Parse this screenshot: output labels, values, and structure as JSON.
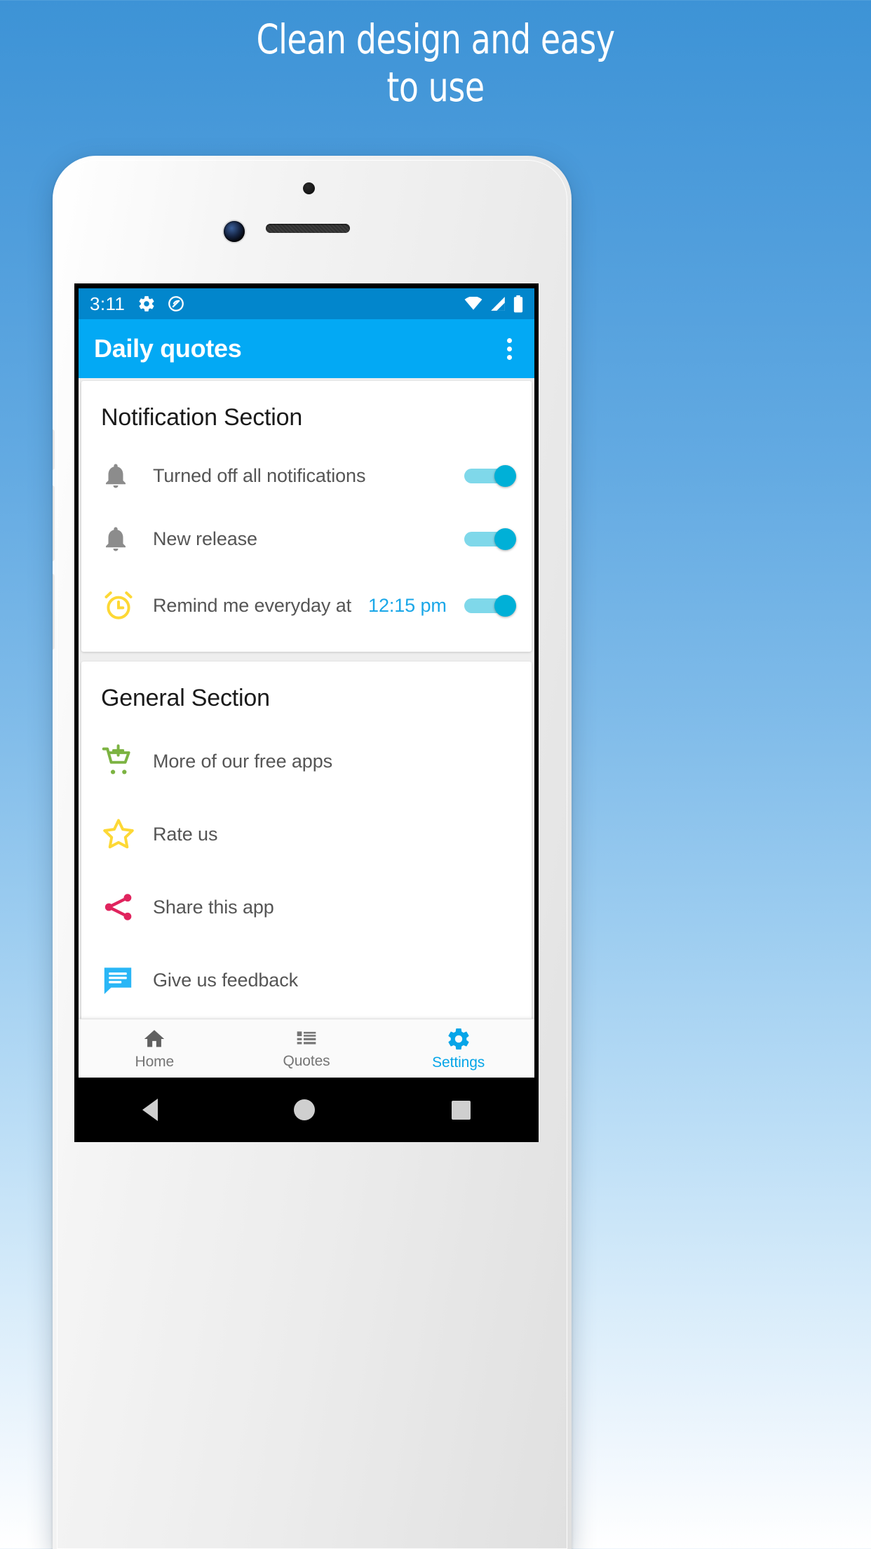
{
  "headline": {
    "line1": "Clean design and easy",
    "line2": "to use"
  },
  "status_bar": {
    "time": "3:11",
    "icons": [
      "gear-icon",
      "do-not-disturb-icon"
    ],
    "right_icons": [
      "wifi-icon",
      "signal-icon",
      "battery-icon"
    ]
  },
  "app_bar": {
    "title": "Daily quotes",
    "overflow": "more-options"
  },
  "notification_section": {
    "title": "Notification Section",
    "rows": [
      {
        "icon": "bell-icon",
        "label": "Turned off all notifications",
        "toggle": "on"
      },
      {
        "icon": "bell-icon",
        "label": "New release",
        "toggle": "on"
      },
      {
        "icon": "alarm-clock-icon",
        "label": "Remind me everyday at",
        "value": "12:15 pm",
        "toggle": "on"
      }
    ]
  },
  "general_section": {
    "title": "General Section",
    "rows": [
      {
        "icon": "add-to-cart-icon",
        "label": "More of our free apps"
      },
      {
        "icon": "star-icon",
        "label": "Rate us"
      },
      {
        "icon": "share-icon",
        "label": "Share this app"
      },
      {
        "icon": "feedback-icon",
        "label": "Give us feedback"
      }
    ]
  },
  "bottom_nav": {
    "items": [
      {
        "icon": "home-icon",
        "label": "Home",
        "active": false
      },
      {
        "icon": "list-icon",
        "label": "Quotes",
        "active": false
      },
      {
        "icon": "gear-icon",
        "label": "Settings",
        "active": true
      }
    ]
  },
  "android_nav": {
    "back": "back-button",
    "home": "home-button",
    "recents": "recents-button"
  },
  "colors": {
    "background_blue": "#3d93d6",
    "status_bar": "#0286cc",
    "app_bar": "#03a9f4",
    "accent_blue": "#1aa7e8",
    "toggle_on": "#00b0d7",
    "cart_green": "#7cb342",
    "star_yellow": "#fdd835",
    "share_pink": "#e0245e",
    "feedback_blue": "#29b6f6",
    "alarm_yellow": "#fdd835"
  }
}
